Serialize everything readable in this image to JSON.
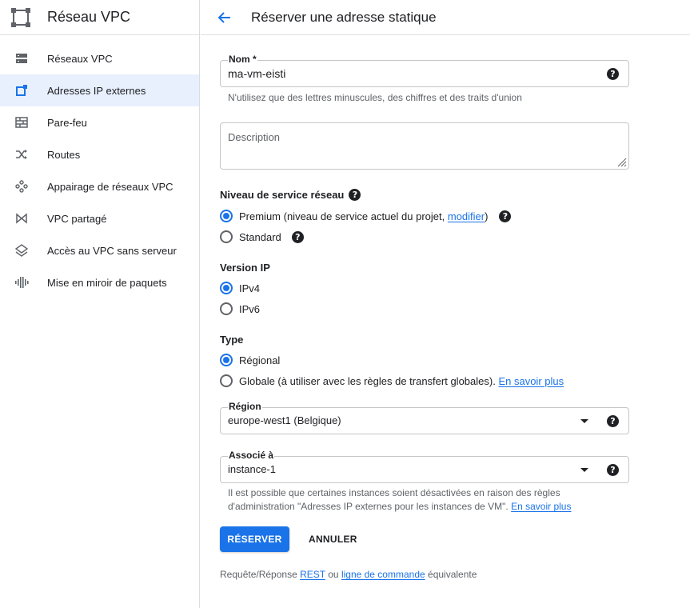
{
  "sidebar": {
    "title": "Réseau VPC",
    "items": [
      {
        "label": "Réseaux VPC",
        "icon": "vpc-networks-icon"
      },
      {
        "label": "Adresses IP externes",
        "icon": "external-ip-icon"
      },
      {
        "label": "Pare-feu",
        "icon": "firewall-icon"
      },
      {
        "label": "Routes",
        "icon": "routes-icon"
      },
      {
        "label": "Appairage de réseaux VPC",
        "icon": "vpc-peering-icon"
      },
      {
        "label": "VPC partagé",
        "icon": "shared-vpc-icon"
      },
      {
        "label": "Accès au VPC sans serveur",
        "icon": "serverless-vpc-icon"
      },
      {
        "label": "Mise en miroir de paquets",
        "icon": "packet-mirroring-icon"
      }
    ],
    "active_index": 1
  },
  "header": {
    "title": "Réserver une adresse statique"
  },
  "form": {
    "name": {
      "label": "Nom *",
      "value": "ma-vm-eisti",
      "hint": "N'utilisez que des lettres minuscules, des chiffres et des traits d'union"
    },
    "description": {
      "placeholder": "Description"
    },
    "network_tier": {
      "title": "Niveau de service réseau",
      "premium_text": "Premium (niveau de service actuel du projet, ",
      "premium_link": "modifier",
      "premium_close": ")",
      "standard": "Standard",
      "selected": "premium"
    },
    "ip_version": {
      "title": "Version IP",
      "options": [
        "IPv4",
        "IPv6"
      ],
      "selected": "IPv4"
    },
    "type": {
      "title": "Type",
      "regional": "Régional",
      "global_text": "Globale (à utiliser avec les règles de transfert globales).",
      "global_link": "En savoir plus",
      "selected": "regional"
    },
    "region": {
      "label": "Région",
      "value": "europe-west1 (Belgique)"
    },
    "attached_to": {
      "label": "Associé à",
      "value": "instance-1",
      "hint_line1": "Il est possible que certaines instances soient désactivées en raison des règles",
      "hint_line2": "d'administration \"Adresses IP externes pour les instances de VM\".",
      "hint_link": "En savoir plus"
    },
    "reserve_button": "RÉSERVER",
    "cancel_button": "ANNULER",
    "footer": {
      "prefix": "Requête/Réponse",
      "rest_link": "REST",
      "middle": "ou",
      "cli_link": "ligne de commande",
      "suffix": "équivalente"
    }
  },
  "colors": {
    "accent": "#1a73e8",
    "active_nav_bg": "#e8f0fe",
    "text": "#202124",
    "secondary_text": "#5f6368"
  }
}
